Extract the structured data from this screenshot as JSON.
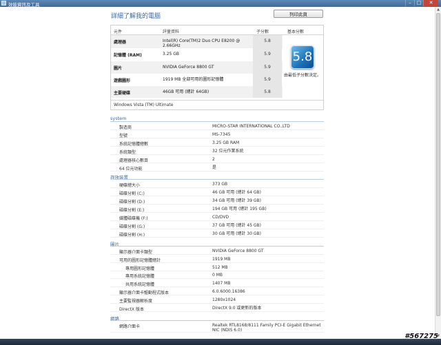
{
  "window": {
    "title": "效能資訊及工具",
    "controls": {
      "minimize": "–",
      "maximize": "□",
      "close": "✕"
    }
  },
  "header": {
    "page_title": "詳細了解我的電腦",
    "print_button": "列印此頁"
  },
  "rating": {
    "columns": [
      "元件",
      "評量資料",
      "子分數",
      "基本分數"
    ],
    "rows": [
      {
        "component": "處理器",
        "details": "Intel(R) Core(TM)2 Duo CPU E8200 @ 2.66GHz",
        "subscore": "5.8"
      },
      {
        "component": "記憶體 (RAM)",
        "details": "3.25 GB",
        "subscore": "5.9"
      },
      {
        "component": "圖片",
        "details": "NVIDIA GeForce 8800 GT",
        "subscore": "5.9"
      },
      {
        "component": "遊戲圖形",
        "details": "1919 MB 全部可用的圖形記憶體",
        "subscore": "5.9"
      },
      {
        "component": "主要硬碟",
        "details": "46GB 可用 (總計 64GB)",
        "subscore": "5.8"
      }
    ],
    "base_score": "5.8",
    "base_score_caption": "由最低子分數決定。",
    "os": "Windows Vista (TM) Ultimate"
  },
  "sections": [
    {
      "title": "system",
      "rows": [
        {
          "label": "製造商",
          "value": "MICRO-STAR INTERNATIONAL CO.,LTD",
          "indent": 0
        },
        {
          "label": "型號",
          "value": "MS-7345",
          "indent": 0
        },
        {
          "label": "系統記憶體總數",
          "value": "3.25 GB RAM",
          "indent": 0
        },
        {
          "label": "系統類型",
          "value": "32 位元作業系統",
          "indent": 0
        },
        {
          "label": "處理器核心數目",
          "value": "2",
          "indent": 0
        },
        {
          "label": "64 位元功能",
          "value": "是",
          "indent": 0
        }
      ]
    },
    {
      "title": "存放裝置",
      "rows": [
        {
          "label": "硬碟總大小",
          "value": "373 GB",
          "indent": 0
        },
        {
          "label": "磁碟分割 (C:)",
          "value": "46 GB 可用 (總計 64 GB)",
          "indent": 0
        },
        {
          "label": "磁碟分割 (D:)",
          "value": "34 GB 可用 (總計 39 GB)",
          "indent": 0
        },
        {
          "label": "磁碟分割 (E:)",
          "value": "194 GB 可用 (總計 195 GB)",
          "indent": 0
        },
        {
          "label": "媒體磁碟機 (F:)",
          "value": "CD/DVD",
          "indent": 0
        },
        {
          "label": "磁碟分割 (G:)",
          "value": "37 GB 可用 (總計 45 GB)",
          "indent": 0
        },
        {
          "label": "磁碟分割 (H:)",
          "value": "30 GB 可用 (總計 30 GB)",
          "indent": 0
        }
      ]
    },
    {
      "title": "圖片",
      "rows": [
        {
          "label": "顯示器介面卡類型",
          "value": "NVIDIA GeForce 8800 GT",
          "indent": 0
        },
        {
          "label": "可用的圖形記憶體總計",
          "value": "1919 MB",
          "indent": 0
        },
        {
          "label": "專用圖形記憶體",
          "value": "512 MB",
          "indent": 1
        },
        {
          "label": "專用系統記憶體",
          "value": "0 MB",
          "indent": 1
        },
        {
          "label": "共用系統記憶體",
          "value": "1407 MB",
          "indent": 1
        },
        {
          "label": "顯示器介面卡驅動程式版本",
          "value": "6.0.6000.16386",
          "indent": 0
        },
        {
          "label": "主要監視器解析度",
          "value": "1280x1024",
          "indent": 0
        },
        {
          "label": "DirectX 版本",
          "value": "DirectX 9.0 或更新的版本",
          "indent": 0
        }
      ]
    },
    {
      "title": "網路",
      "rows": [
        {
          "label": "網路介面卡",
          "value": "Realtek RTL8168/8111 Family PCI-E Gigabit Ethernet NIC (NDIS 6.0)",
          "indent": 0
        }
      ]
    }
  ],
  "watermark": "#567275"
}
